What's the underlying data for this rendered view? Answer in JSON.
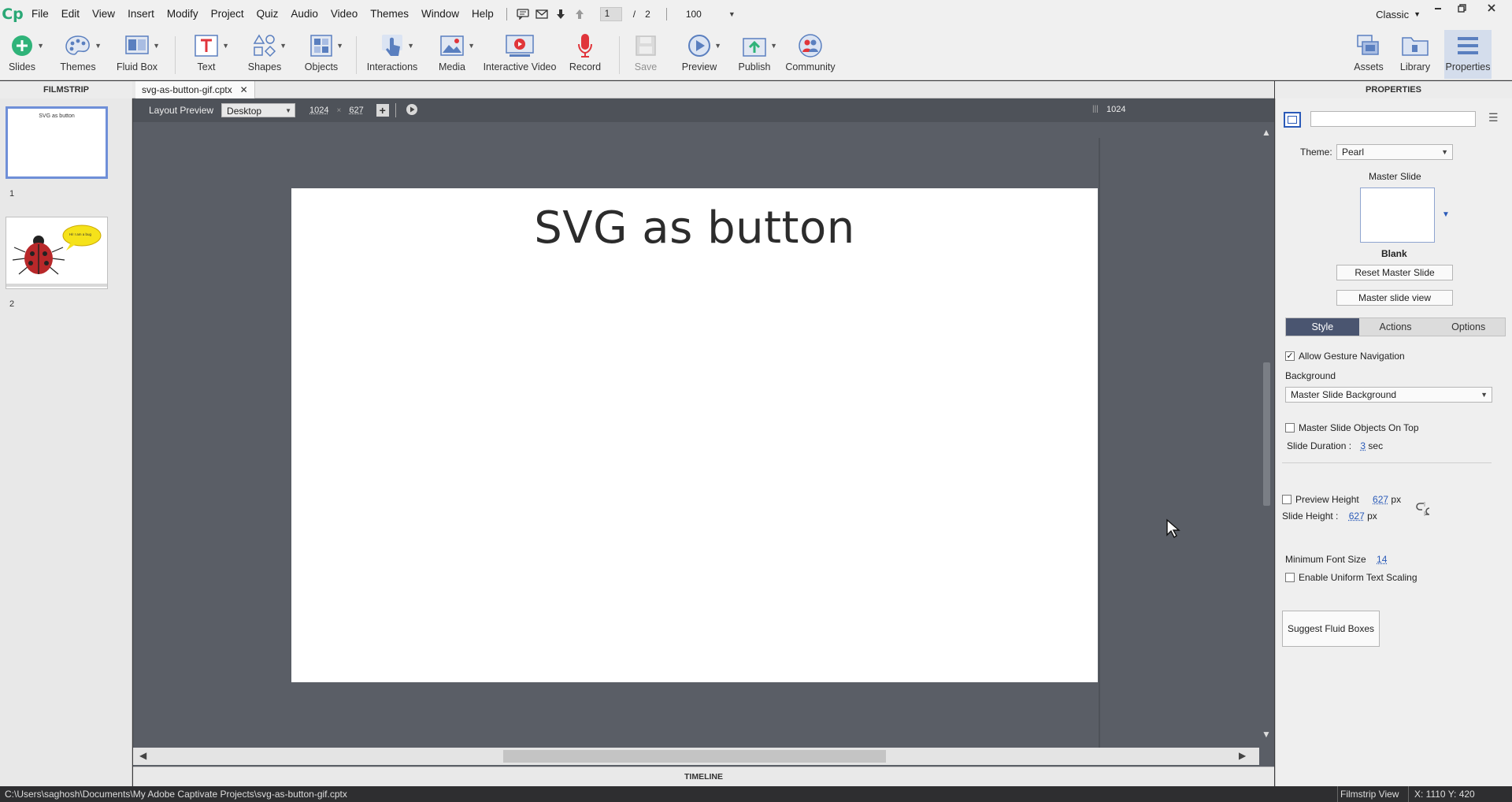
{
  "app": {
    "logo": "Cp"
  },
  "menu": {
    "items": [
      "File",
      "Edit",
      "View",
      "Insert",
      "Modify",
      "Project",
      "Quiz",
      "Audio",
      "Video",
      "Themes",
      "Window",
      "Help"
    ],
    "current_slide": "1",
    "slide_separator": "/",
    "total_slides": "2",
    "zoom": "100",
    "workspace": "Classic"
  },
  "toolbar": {
    "slides": "Slides",
    "themes": "Themes",
    "fluid_box": "Fluid Box",
    "text": "Text",
    "shapes": "Shapes",
    "objects": "Objects",
    "interactions": "Interactions",
    "media": "Media",
    "interactive_video": "Interactive Video",
    "record": "Record",
    "save": "Save",
    "preview": "Preview",
    "publish": "Publish",
    "community": "Community",
    "assets": "Assets",
    "library": "Library",
    "properties": "Properties"
  },
  "filmstrip": {
    "header": "FILMSTRIP",
    "slides": [
      {
        "number": "1",
        "title": "SVG as button"
      },
      {
        "number": "2",
        "bubble_text": "Hi! I am a bug"
      }
    ]
  },
  "document": {
    "tab_name": "svg-as-button-gif.cptx",
    "layout_preview_label": "Layout Preview",
    "device": "Desktop",
    "width": "1024",
    "height": "627",
    "times": "×",
    "ruler_value": "1024",
    "slide_title": "SVG as button",
    "timeline_label": "TIMELINE"
  },
  "properties": {
    "header": "PROPERTIES",
    "name_value": "",
    "theme_label": "Theme:",
    "theme_value": "Pearl",
    "master_slide_label": "Master Slide",
    "master_name": "Blank",
    "reset_master": "Reset Master Slide",
    "master_view": "Master slide view",
    "tabs": [
      "Style",
      "Actions",
      "Options"
    ],
    "allow_gesture": "Allow Gesture Navigation",
    "background_label": "Background",
    "background_value": "Master Slide Background",
    "master_objects_on_top": "Master Slide Objects On Top",
    "slide_duration_label": "Slide Duration :",
    "slide_duration_value": "3",
    "slide_duration_unit": "sec",
    "preview_height_label": "Preview Height",
    "preview_height_value": "627",
    "slide_height_label": "Slide Height :",
    "slide_height_value": "627",
    "px": "px",
    "min_font_label": "Minimum Font Size",
    "min_font_value": "14",
    "uniform_scaling": "Enable Uniform Text Scaling",
    "suggest_fluid": "Suggest Fluid Boxes"
  },
  "status": {
    "path": "C:\\Users\\saghosh\\Documents\\My Adobe Captivate Projects\\svg-as-button-gif.cptx",
    "view": "Filmstrip View",
    "coords": "X: 1110 Y: 420"
  },
  "colors": {
    "accent": "#4a5570",
    "stage_bg": "#5a5e66",
    "logo": "#2aa876",
    "record_red": "#e0353b",
    "selected_thumb": "#6f8fd8"
  }
}
